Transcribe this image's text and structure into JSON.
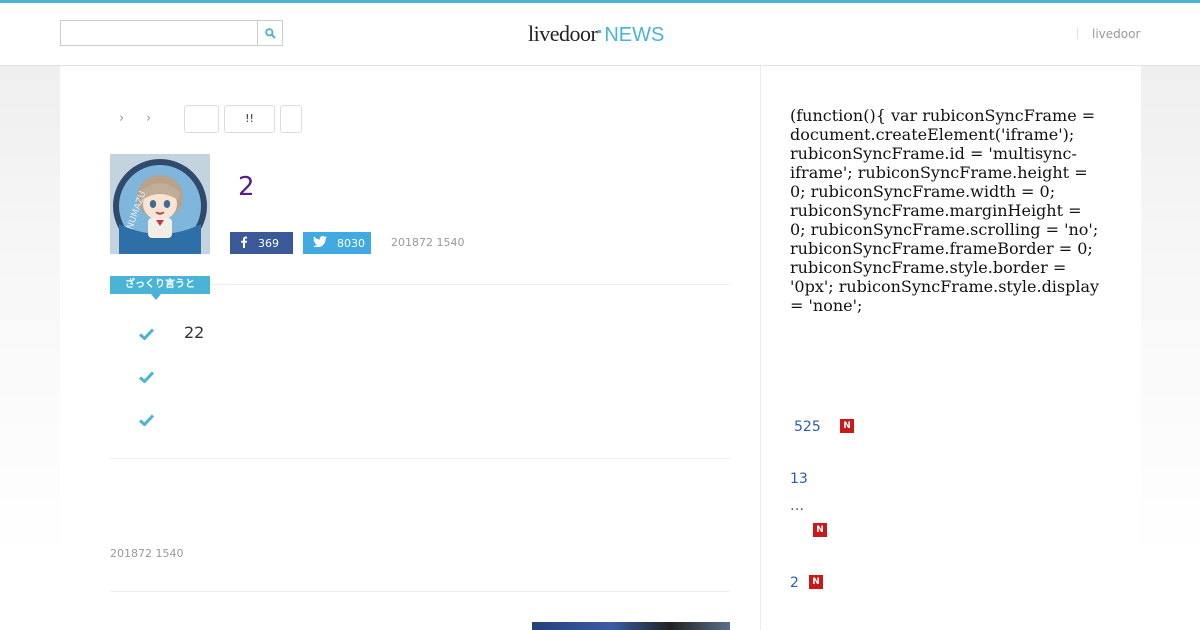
{
  "header": {
    "search": {
      "placeholder": "",
      "value": ""
    },
    "logo": {
      "brand": "livedoor",
      "product": "NEWS"
    },
    "links": [
      {
        "label": "livedoor"
      }
    ]
  },
  "breadcrumb": {
    "separators": [
      "›",
      "›"
    ],
    "tags": [
      "",
      "!!",
      ""
    ]
  },
  "article": {
    "title": "2",
    "share": {
      "facebook_count": "369",
      "twitter_count": "8030"
    },
    "date": "201872 1540",
    "summary_label": "ざっくり言うと",
    "summary_points": [
      "22",
      "",
      ""
    ],
    "footer_date": "201872 1540"
  },
  "sidebar": {
    "code_text": "(function(){ var rubiconSyncFrame = document.createElement('iframe'); rubiconSyncFrame.id = 'multisync-iframe'; rubiconSyncFrame.height = 0; rubiconSyncFrame.width = 0; rubiconSyncFrame.marginHeight = 0; rubiconSyncFrame.scrolling = 'no'; rubiconSyncFrame.frameBorder = 0; rubiconSyncFrame.style.border = '0px'; rubiconSyncFrame.style.display = 'none';",
    "ranking": [
      {
        "text": "525",
        "is_new": true
      },
      {
        "text": "13",
        "is_new": false
      },
      {
        "text": "…",
        "is_new": true
      },
      {
        "text": "2",
        "is_new": true
      }
    ],
    "new_badge_label": "N"
  },
  "colors": {
    "accent": "#4ab4d6",
    "title": "#5a1b8e",
    "facebook": "#3b5998",
    "twitter": "#41abe1",
    "link": "#2a5db0",
    "new_badge": "#c81a1a"
  }
}
